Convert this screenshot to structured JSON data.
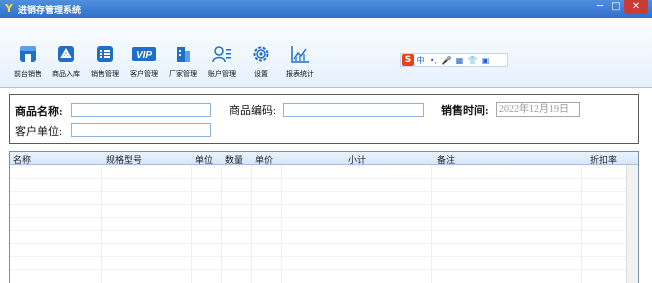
{
  "window": {
    "title": "进销存管理系统",
    "app_icon": "Y",
    "minimize_glyph": "─",
    "maximize_glyph": "□",
    "close_glyph": "✕"
  },
  "toolbar": {
    "items": [
      {
        "label": "前台销售",
        "icon": "storefront-icon",
        "color": "#1f6fc8"
      },
      {
        "label": "商品入库",
        "icon": "product-inbound-icon",
        "color": "#1f6fc8"
      },
      {
        "label": "销售管理",
        "icon": "list-icon",
        "color": "#1f6fc8"
      },
      {
        "label": "客户管理",
        "icon": "vip-icon",
        "color": "#1f6fc8"
      },
      {
        "label": "厂家管理",
        "icon": "building-icon",
        "color": "#1f6fc8"
      },
      {
        "label": "账户管理",
        "icon": "user-list-icon",
        "color": "#1f6fc8"
      },
      {
        "label": "设置",
        "icon": "gear-icon",
        "color": "#1f6fc8"
      },
      {
        "label": "报表统计",
        "icon": "chart-icon",
        "color": "#1f6fc8"
      }
    ]
  },
  "ime": {
    "logo": "S",
    "items": [
      "中",
      "•,",
      "🎤",
      "▦",
      "👕",
      "▣"
    ]
  },
  "search": {
    "product_name_label": "商品名称:",
    "product_name_value": "",
    "product_code_label": "商品编码:",
    "product_code_value": "",
    "sale_time_label": "销售时间:",
    "sale_time_value": "2022年12月19日",
    "customer_label": "客户单位:",
    "customer_value": ""
  },
  "grid": {
    "columns": [
      "名称",
      "规格型号",
      "单位",
      "数量",
      "单价",
      "小计",
      "备注",
      "折扣率"
    ],
    "rows": []
  }
}
